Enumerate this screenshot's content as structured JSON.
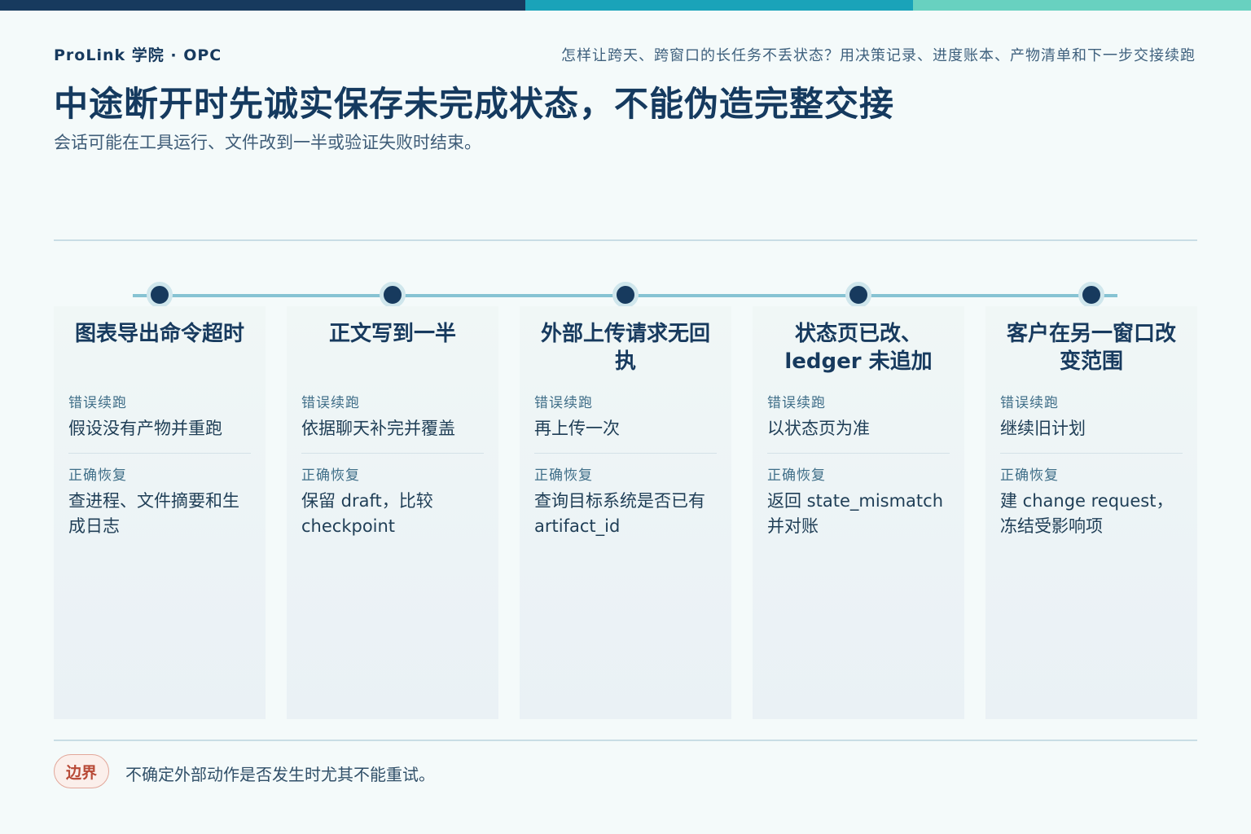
{
  "header": {
    "brand": "ProLink 学院 · OPC",
    "question": "怎样让跨天、跨窗口的长任务不丢状态？用决策记录、进度账本、产物清单和下一步交接续跑",
    "title": "中途断开时先诚实保存未完成状态，不能伪造完整交接",
    "subtitle": "会话可能在工具运行、文件改到一半或验证失败时结束。"
  },
  "colors": {
    "accent_dark": "#173a5e",
    "accent_teal": "#1aa3b9",
    "accent_mint": "#68d1c0",
    "warning": "#b84a37"
  },
  "cards": [
    {
      "title": "图表导出命令超时",
      "wrong_label": "错误续跑",
      "wrong_value": "假设没有产物并重跑",
      "right_label": "正确恢复",
      "right_value": "查进程、文件摘要和生成日志"
    },
    {
      "title": "正文写到一半",
      "wrong_label": "错误续跑",
      "wrong_value": "依据聊天补完并覆盖",
      "right_label": "正确恢复",
      "right_value": "保留 draft，比较 checkpoint"
    },
    {
      "title": "外部上传请求无回执",
      "wrong_label": "错误续跑",
      "wrong_value": "再上传一次",
      "right_label": "正确恢复",
      "right_value": "查询目标系统是否已有 artifact_id"
    },
    {
      "title": "状态页已改、ledger 未追加",
      "wrong_label": "错误续跑",
      "wrong_value": "以状态页为准",
      "right_label": "正确恢复",
      "right_value": "返回 state_mismatch 并对账"
    },
    {
      "title": "客户在另一窗口改变范围",
      "wrong_label": "错误续跑",
      "wrong_value": "继续旧计划",
      "right_label": "正确恢复",
      "right_value": "建 change request，冻结受影响项"
    }
  ],
  "footer": {
    "badge": "边界",
    "text": "不确定外部动作是否发生时尤其不能重试。"
  }
}
